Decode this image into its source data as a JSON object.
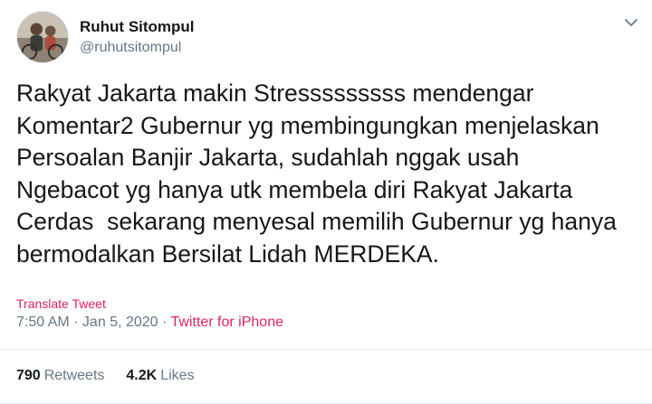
{
  "user": {
    "display_name": "Ruhut Sitompul",
    "handle": "@ruhutsitompul"
  },
  "tweet": {
    "text": "Rakyat Jakarta makin Stresssssssss mendengar\nKomentar2 Gubernur yg membingungkan menjelaskan\nPersoalan Banjir Jakarta, sudahlah nggak usah\nNgebacot yg hanya utk membela diri Rakyat Jakarta\nCerdas  sekarang menyesal memilih Gubernur yg hanya\nbermodalkan Bersilat Lidah MERDEKA.",
    "translate_label": "Translate Tweet",
    "time": "7:50 AM",
    "separator": " · ",
    "date": "Jan 5, 2020",
    "source": "Twitter for iPhone"
  },
  "stats": {
    "retweets_count": "790",
    "retweets_label": "Retweets",
    "likes_count": "4.2K",
    "likes_label": "Likes"
  },
  "colors": {
    "accent": "#e0245e",
    "secondary_text": "#657786",
    "primary_text": "#14171a",
    "divider": "#e6ecf0"
  },
  "icons": {
    "menu": "chevron-down-icon"
  }
}
